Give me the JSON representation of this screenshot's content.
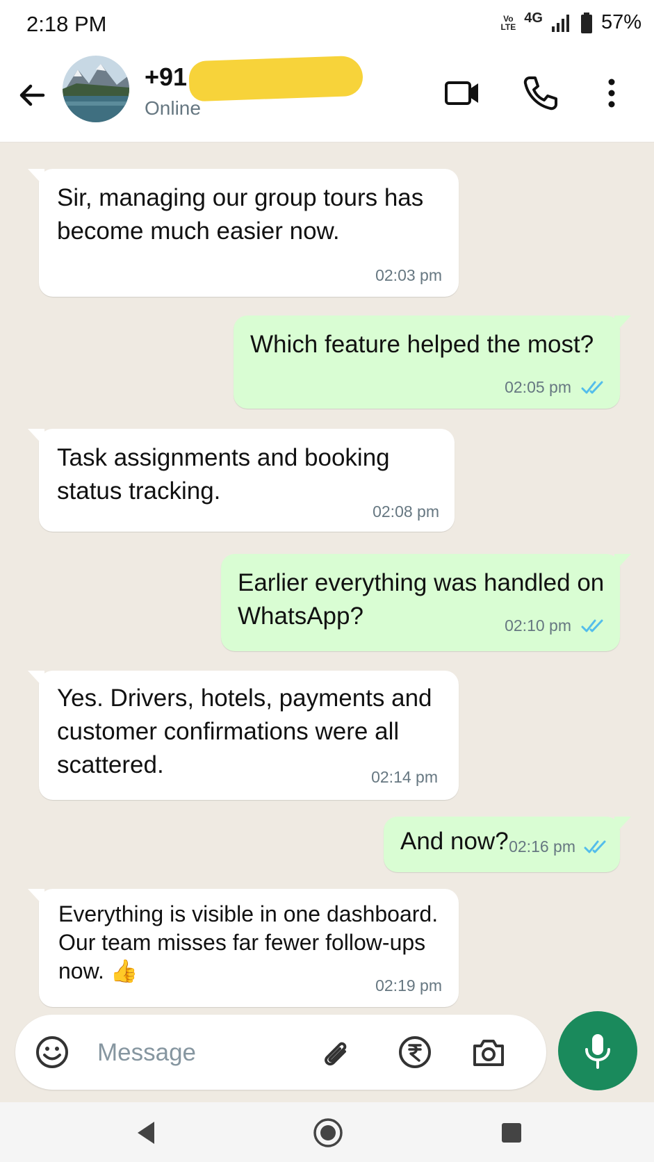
{
  "status_bar": {
    "time": "2:18 PM",
    "volte_top": "Vo",
    "volte_bottom": "LTE",
    "network": "4G",
    "battery": "57%"
  },
  "header": {
    "contact_name": "+91",
    "contact_status": "Online",
    "icons": [
      "back-arrow-icon",
      "video-call-icon",
      "voice-call-icon",
      "more-options-icon"
    ]
  },
  "messages": [
    {
      "direction": "incoming",
      "lines": [
        "Sir, managing our group tours has",
        "become much easier now."
      ],
      "time": "02:03 pm"
    },
    {
      "direction": "outgoing",
      "lines": [
        "Which feature helped the most?"
      ],
      "time": "02:05 pm",
      "read": true
    },
    {
      "direction": "incoming",
      "lines": [
        "Task assignments and booking",
        "status tracking."
      ],
      "time": "02:08 pm"
    },
    {
      "direction": "outgoing",
      "lines": [
        "Earlier everything was handled on",
        "WhatsApp?"
      ],
      "time": "02:10 pm",
      "read": true
    },
    {
      "direction": "incoming",
      "lines": [
        "Yes. Drivers, hotels, payments and",
        "customer confirmations were all",
        "scattered."
      ],
      "time": "02:14 pm"
    },
    {
      "direction": "outgoing",
      "lines": [
        "And now?"
      ],
      "time": "02:16 pm",
      "read": true
    },
    {
      "direction": "incoming",
      "lines": [
        "Everything is visible in one dashboard.",
        "Our team misses far fewer follow-ups",
        "now. 👍"
      ],
      "time": "02:19 pm"
    }
  ],
  "composer": {
    "placeholder": "Message",
    "icons": [
      "emoji-icon",
      "attach-icon",
      "rupee-payment-icon",
      "camera-icon",
      "mic-icon"
    ]
  },
  "colors": {
    "chat_bg": "#efeae2",
    "incoming_bubble": "#ffffff",
    "outgoing_bubble": "#d9fdd3",
    "read_ticks": "#53bdeb",
    "accent": "#1a8a5c"
  }
}
